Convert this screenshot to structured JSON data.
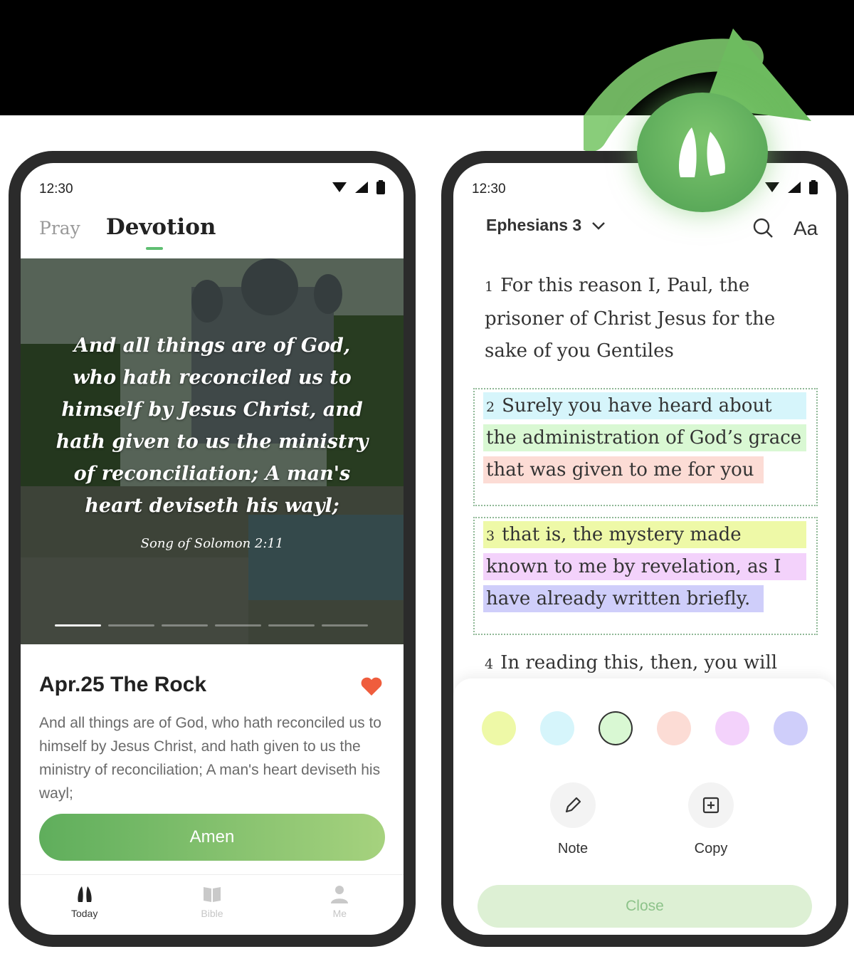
{
  "left": {
    "status": {
      "time": "12:30"
    },
    "tabs": {
      "pray": "Pray",
      "devotion": "Devotion"
    },
    "hero": {
      "quote": "And all things are of God, who hath reconciled us to himself by Jesus Christ, and hath given to us the ministry of reconciliation; A man's heart deviseth his wayl;",
      "reference": "Song of Solomon 2:11",
      "slides_total": 6,
      "active_slide": 1
    },
    "card": {
      "title": "Apr.25 The Rock",
      "body": "And all things are of God, who hath reconciled us to himself by Jesus Christ, and hath given to us the ministry of reconciliation; A man's heart deviseth his wayl;",
      "favorite": true,
      "button": "Amen"
    },
    "nav": [
      {
        "label": "Today",
        "icon": "praying-hands-icon",
        "active": true
      },
      {
        "label": "Bible",
        "icon": "book-icon",
        "active": false
      },
      {
        "label": "Me",
        "icon": "person-icon",
        "active": false
      }
    ]
  },
  "right": {
    "status": {
      "time": "12:30"
    },
    "chapter": "Ephesians 3",
    "font_button": "Aa",
    "verses": {
      "v1": {
        "num": "1",
        "text": "For this reason I, Paul, the prisoner of Christ Jesus for the sake of you Gentiles"
      },
      "v2": {
        "num": "2",
        "lines": [
          "Surely you have heard about",
          "the administration of God’s grace",
          "that was given to me for you"
        ]
      },
      "v3": {
        "num": "3",
        "lines": [
          "that is, the mystery made",
          "known to me by revelation, as I",
          "have already written briefly."
        ]
      },
      "v4": {
        "num": "4",
        "text": "In reading this, then, you will"
      }
    },
    "highlight_colors": [
      "#eef9a7",
      "#d6f5fb",
      "#d9f8d3",
      "#fcdcd5",
      "#f3d2fb",
      "#cfcefa"
    ],
    "selected_color": "#d9f8d3",
    "actions": {
      "note": "Note",
      "copy": "Copy"
    },
    "close": "Close"
  }
}
